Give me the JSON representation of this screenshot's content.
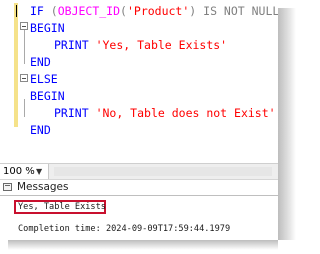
{
  "editor": {
    "lines": [
      {
        "k1": "IF",
        "p1": " (",
        "fn": "OBJECT_ID",
        "p2": "(",
        "str": "'Product'",
        "p3": ")",
        "k2": " IS NOT NULL",
        "p4": " )"
      },
      {
        "kw": "BEGIN"
      },
      {
        "kw": "PRINT",
        "str": "'Yes, Table Exists'"
      },
      {
        "kw": "END"
      },
      {
        "kw": "ELSE"
      },
      {
        "kw": "BEGIN"
      },
      {
        "kw": "PRINT",
        "str": "'No, Table does not Exist'"
      },
      {
        "kw": "END"
      }
    ]
  },
  "zoom": {
    "value": "100 %"
  },
  "results": {
    "tab_label": "Messages",
    "output_line": "Yes, Table Exists",
    "completion": "Completion time: 2024-09-09T17:59:44.1979"
  },
  "colors": {
    "keyword": "#0000ff",
    "function": "#ff00ff",
    "string": "#ff0000",
    "highlight": "#c8102e"
  }
}
